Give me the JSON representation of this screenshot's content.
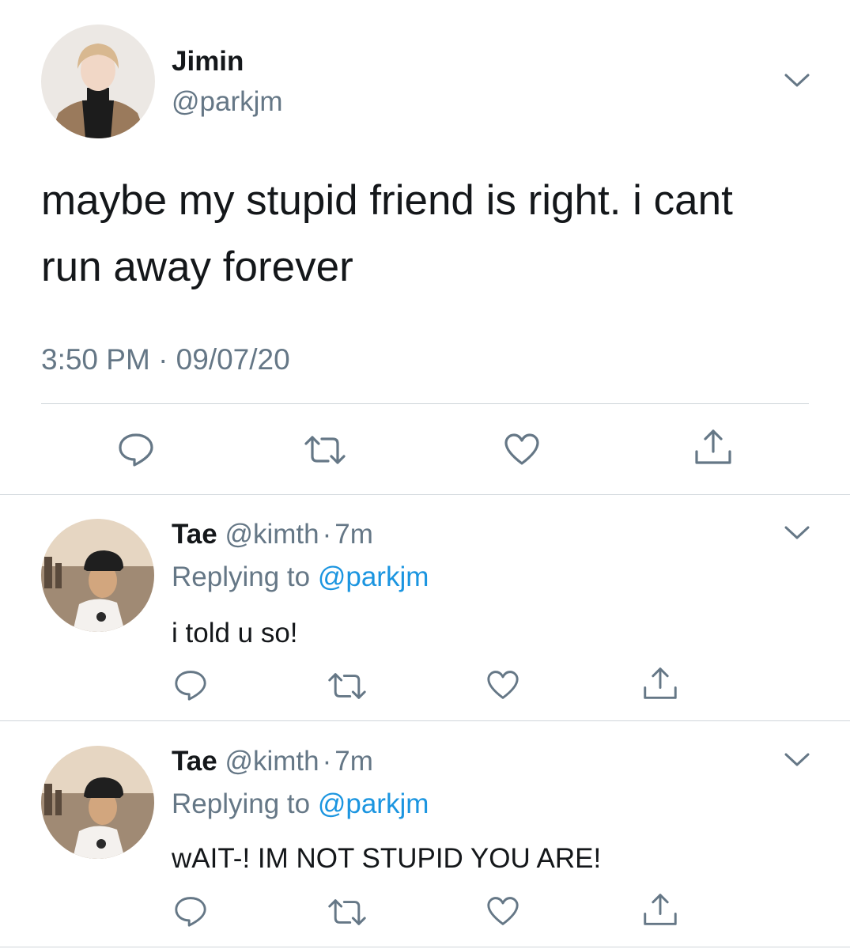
{
  "main_tweet": {
    "display_name": "Jimin",
    "handle": "@parkjm",
    "text_lines": [
      "maybe my stupid friend is right. i cant",
      "run away forever"
    ],
    "timestamp": "3:50 PM · 09/07/20"
  },
  "replies": [
    {
      "display_name": "Tae",
      "handle": "@kimth",
      "separator": "·",
      "age": "7m",
      "replying_prefix": "Replying to",
      "replying_handle": "@parkjm",
      "text": "i told u so!"
    },
    {
      "display_name": "Tae",
      "handle": "@kimth",
      "separator": "·",
      "age": "7m",
      "replying_prefix": "Replying to",
      "replying_handle": "@parkjm",
      "text": "wAIT-! IM NOT STUPID YOU ARE!"
    }
  ],
  "icons": [
    "chevron-down-icon",
    "reply-icon",
    "retweet-icon",
    "like-icon",
    "share-icon"
  ],
  "colors": {
    "text": "#14171a",
    "secondary": "#657786",
    "link": "#1b95e0",
    "divider": "#cfd5da"
  }
}
